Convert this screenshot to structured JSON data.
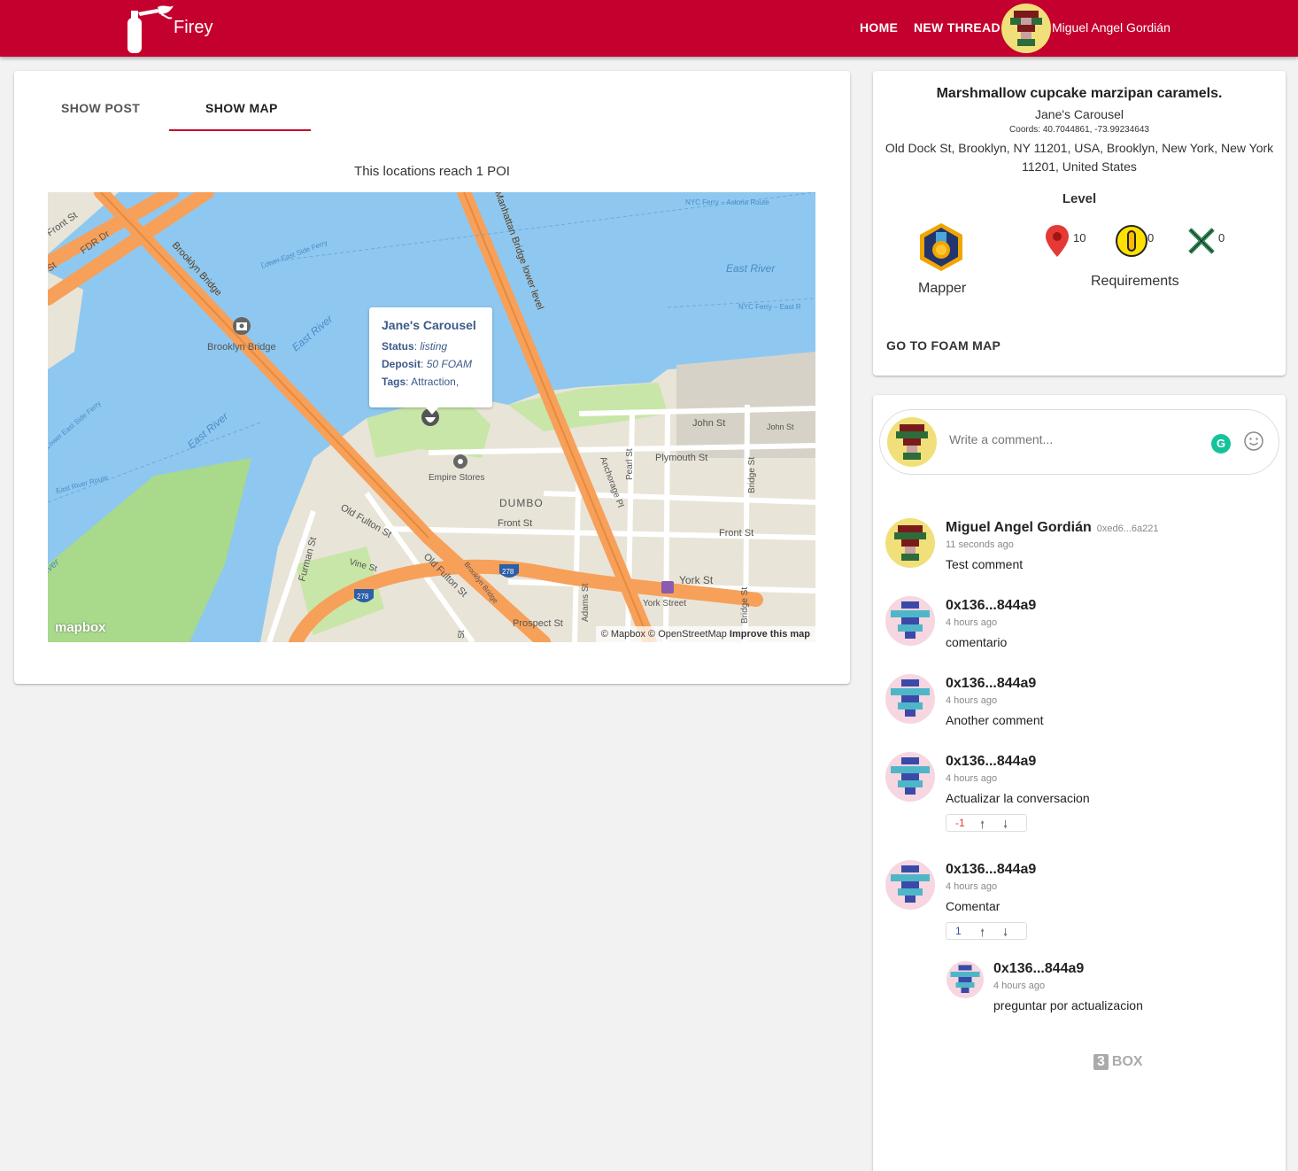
{
  "header": {
    "brand": "Firey",
    "nav": {
      "home": "HOME",
      "new_thread": "NEW THREAD"
    },
    "user_name": "Miguel Angel Gordián",
    "colors": {
      "primary": "#c4002e"
    }
  },
  "main": {
    "tabs": [
      {
        "label": "SHOW POST"
      },
      {
        "label": "SHOW MAP"
      }
    ],
    "reach_text": "This locations reach 1 POI",
    "map": {
      "popup": {
        "title": "Jane's Carousel",
        "status_label": "Status",
        "status_value": "listing",
        "deposit_label": "Deposit",
        "deposit_value": "50 FOAM",
        "tags_label": "Tags",
        "tags_value": "Attraction,"
      },
      "labels": {
        "manhattan_bridge": "Manhattan Bridge lower level",
        "brooklyn_bridge": "Brooklyn Bridge",
        "brooklyn_bridge_poi": "Brooklyn Bridge",
        "east_river_1": "East River",
        "east_river_2": "East River",
        "east_river_3": "East River",
        "ferry_1": "NYC Ferry – Astoria Route",
        "ferry_2": "NYC Ferry – East R",
        "ferry_3": "Lower East Side Ferry",
        "ferry_4": "Lower East Side Ferry",
        "ferry_5": "East River Route",
        "front_st_left": "Front St",
        "fdr_dr": "FDR Dr",
        "st_left": "St",
        "empire_stores": "Empire Stores",
        "dumbo": "DUMBO",
        "front_st": "Front St",
        "front_st_2": "Front St",
        "john_st": "John St",
        "john_st_2": "John St",
        "plymouth_st": "Plymouth St",
        "pearl_st": "Pearl St",
        "bridge_st": "Bridge St",
        "bridge_st_2": "Bridge St",
        "anchorage_pl": "Anchorage Pl",
        "old_fulton_st": "Old Fulton St",
        "old_fulton_st_2": "Old Fulton St",
        "vine_st": "Vine St",
        "furman_st": "Furman St",
        "adams_st": "Adams St",
        "york_st": "York St",
        "york_street": "York Street",
        "prospect_st": "Prospect St",
        "brooklyn_bridge_ramp": "Brooklyn Bridge",
        "i278": "278",
        "i278_2": "278",
        "st_bottom": "St",
        "river": "iver"
      },
      "attribution": "© Mapbox © OpenStreetMap",
      "improve": "Improve this map",
      "logo": "mapbox"
    }
  },
  "info": {
    "title": "Marshmallow cupcake marzipan caramels.",
    "place": "Jane's Carousel",
    "coords": "Coords: 40.7044861, -73.99234643",
    "address": "Old Dock St, Brooklyn, NY 11201, USA, Brooklyn, New York, New York 11201, United States",
    "level_label": "Level",
    "badge_label": "Mapper",
    "requirements": {
      "pins": "10",
      "coins": "0",
      "swords": "0",
      "label": "Requirements"
    },
    "foam_link": "GO TO FOAM MAP"
  },
  "comments": {
    "input_placeholder": "Write a comment...",
    "grammarly_letter": "G",
    "items": [
      {
        "name": "Miguel Angel Gordián",
        "address": "0xed6...6a221",
        "time": "11 seconds ago",
        "text": "Test comment"
      },
      {
        "name": "0x136...844a9",
        "time": "4 hours ago",
        "text": "comentario"
      },
      {
        "name": "0x136...844a9",
        "time": "4 hours ago",
        "text": "Another comment"
      },
      {
        "name": "0x136...844a9",
        "time": "4 hours ago",
        "text": "Actualizar la conversacion",
        "score": "-1"
      },
      {
        "name": "0x136...844a9",
        "time": "4 hours ago",
        "text": "Comentar",
        "score": "1"
      },
      {
        "name": "0x136...844a9",
        "time": "4 hours ago",
        "text": "preguntar por actualizacion"
      }
    ],
    "box_logo_num": "3",
    "box_logo_text": "BOX"
  }
}
